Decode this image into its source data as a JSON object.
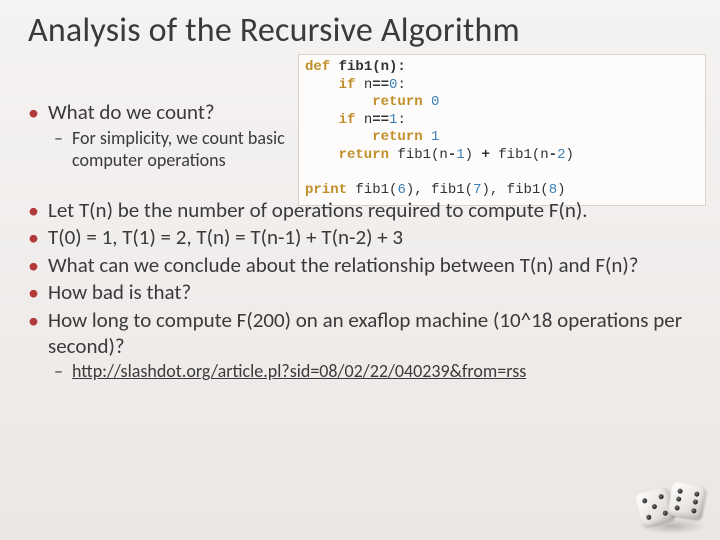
{
  "title": "Analysis of the Recursive Algorithm",
  "code": {
    "l1a": "def",
    "l1b": " fib1(n):",
    "l2a": "    if",
    "l2b": " n",
    "l2c": "==",
    "l2d": "0",
    "l2e": ":",
    "l3a": "        return",
    "l3b": " ",
    "l3c": "0",
    "l4a": "    if",
    "l4b": " n",
    "l4c": "==",
    "l4d": "1",
    "l4e": ":",
    "l5a": "        return",
    "l5b": " ",
    "l5c": "1",
    "l6a": "    return",
    "l6b": " fib1(n",
    "l6c": "-",
    "l6d": "1",
    "l6e": ") ",
    "l6f": "+",
    "l6g": " fib1(n",
    "l6h": "-",
    "l6i": "2",
    "l6j": ")",
    "l7": "",
    "l8a": "print",
    "l8b": " fib1(",
    "l8c": "6",
    "l8d": "), fib1(",
    "l8e": "7",
    "l8f": "), fib1(",
    "l8g": "8",
    "l8h": ")"
  },
  "bullets": {
    "b1": "What do we count?",
    "b1s1": "For simplicity, we count basic computer operations",
    "b2": "Let T(n) be the number of operations required to compute F(n).",
    "b3": "T(0) = 1, T(1) = 2, T(n) = T(n-1) + T(n-2) + 3",
    "b4": "What can we conclude about the relationship between T(n) and F(n)?",
    "b5": "How bad is that?",
    "b6": "How long to compute F(200) on an exaflop machine (10^18 operations per second)?",
    "b6s1": "http://slashdot.org/article.pl?sid=08/02/22/040239&from=rss"
  }
}
